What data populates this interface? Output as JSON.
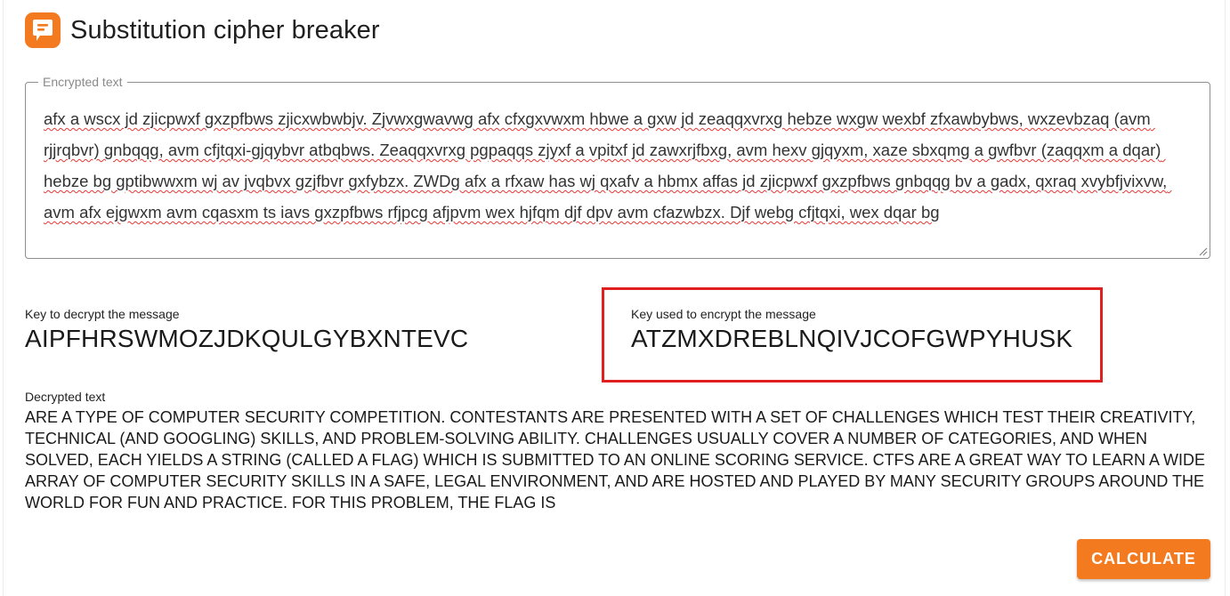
{
  "app": {
    "title": "Substitution cipher breaker",
    "accent_color": "#f47a20",
    "logo_icon": "speech-bubble-icon"
  },
  "encrypted": {
    "legend": "Encrypted text",
    "value": "afx a wscx jd zjicpwxf gxzpfbws zjicxwbwbjv. Zjvwxgwavwg afx cfxgxvwxm hbwe a gxw jd zeaqqxvrxg hebze wxgw wexbf zfxawbybws, wxzevbzaq (avm rjjrqbvr) gnbqqg, avm cfjtqxi-gjqybvr atbqbws. Zeaqqxvrxg pgpaqqs zjyxf a vpitxf jd zawxrjfbxg, avm hexv gjqyxm, xaze sbxqmg a gwfbvr (zaqqxm a dqar) hebze bg gptibwwxm wj av jvqbvx gzjfbvr gxfybzx. ZWDg afx a rfxaw has wj qxafv a hbmx affas jd zjicpwxf gxzpfbws gnbqqg bv a gadx, qxraq xvybfjvixvw, avm afx ejgwxm avm cqasxm ts iavs gxzpfbws rfjpcg afjpvm wex hjfqm djf dpv avm cfazwbzx. Djf webg cfjtqxi, wex dqar bg"
  },
  "decrypt_key": {
    "label": "Key to decrypt the message",
    "value": "AIPFHRSWMOZJDKQULGYBXNTEVC"
  },
  "encrypt_key": {
    "label": "Key used to encrypt the message",
    "value": "ATZMXDREBLNQIVJCOFGWPYHUSK",
    "highlight_color": "#e02020"
  },
  "decrypted": {
    "label": "Decrypted text",
    "value": "ARE A TYPE OF COMPUTER SECURITY COMPETITION. CONTESTANTS ARE PRESENTED WITH A SET OF CHALLENGES WHICH TEST THEIR CREATIVITY, TECHNICAL (AND GOOGLING) SKILLS, AND PROBLEM-SOLVING ABILITY. CHALLENGES USUALLY COVER A NUMBER OF CATEGORIES, AND WHEN SOLVED, EACH YIELDS A STRING (CALLED A FLAG) WHICH IS SUBMITTED TO AN ONLINE SCORING SERVICE. CTFS ARE A GREAT WAY TO LEARN A WIDE ARRAY OF COMPUTER SECURITY SKILLS IN A SAFE, LEGAL ENVIRONMENT, AND ARE HOSTED AND PLAYED BY MANY SECURITY GROUPS AROUND THE WORLD FOR FUN AND PRACTICE. FOR THIS PROBLEM, THE FLAG IS"
  },
  "actions": {
    "calculate_label": "CALCULATE"
  }
}
